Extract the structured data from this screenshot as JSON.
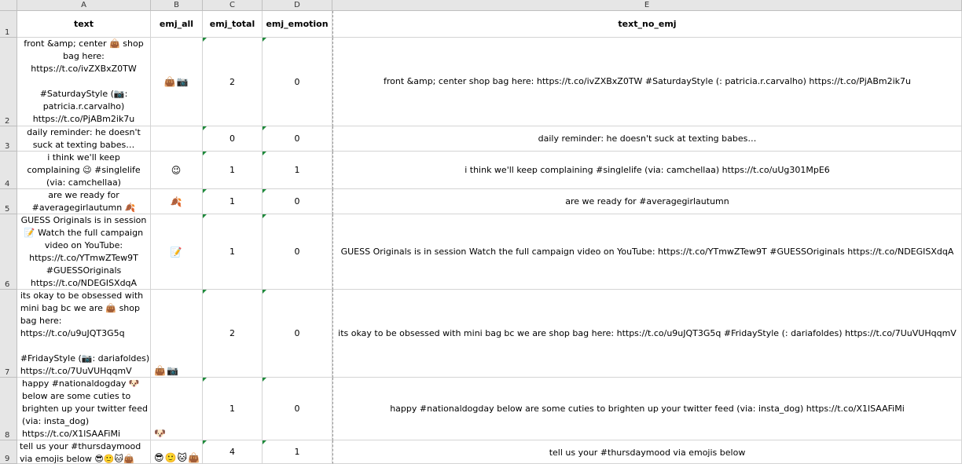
{
  "columns": [
    "A",
    "B",
    "C",
    "D",
    "E"
  ],
  "row_numbers": [
    "1",
    "2",
    "3",
    "4",
    "5",
    "6",
    "7",
    "8",
    "9"
  ],
  "headers": {
    "a": "text",
    "b": "emj_all",
    "c": "emj_total",
    "d": "emj_emotion",
    "e": "text_no_emj"
  },
  "rows": [
    {
      "a": "front &amp; center 👜 shop\nbag here:\nhttps://t.co/ivZXBxZ0TW\n\n#SaturdayStyle (📷:\npatricia.r.carvalho)\nhttps://t.co/PjABm2ik7u",
      "b": "👜📷",
      "c": "2",
      "d": "0",
      "e": "front &amp; center shop bag here: https://t.co/ivZXBxZ0TW #SaturdayStyle (: patricia.r.carvalho) https://t.co/PjABm2ik7u"
    },
    {
      "a": "daily reminder: he doesn't\nsuck at texting babes…",
      "b": "",
      "c": "0",
      "d": "0",
      "e": "daily reminder: he doesn't suck at texting babes…"
    },
    {
      "a": "i think we'll keep\ncomplaining 😉 #singlelife\n(via: camchellaa)",
      "b": "😉",
      "c": "1",
      "d": "1",
      "e": "i think we'll keep complaining #singlelife (via: camchellaa) https://t.co/uUg301MpE6"
    },
    {
      "a": "are we ready for\n#averagegirlautumn 🍂",
      "b": "🍂",
      "c": "1",
      "d": "0",
      "e": "are we ready for #averagegirlautumn"
    },
    {
      "a": "GUESS Originals is in session\n📝 Watch the full campaign\nvideo on YouTube:\nhttps://t.co/YTmwZTew9T\n#GUESSOriginals\nhttps://t.co/NDEGISXdqA",
      "b": "📝",
      "c": "1",
      "d": "0",
      "e": "GUESS Originals is in session Watch the full campaign video on YouTube: https://t.co/YTmwZTew9T #GUESSOriginals https://t.co/NDEGISXdqA"
    },
    {
      "a": "its okay to be obsessed with\nmini bag bc we are 👜 shop\nbag here:\nhttps://t.co/u9uJQT3G5q\n\n#FridayStyle (📷: dariafoldes)\nhttps://t.co/7UuVUHqqmV",
      "b": "👜📷",
      "c": "2",
      "d": "0",
      "e": "its okay to be obsessed with mini bag bc we are shop bag here: https://t.co/u9uJQT3G5q #FridayStyle (: dariafoldes) https://t.co/7UuVUHqqmV"
    },
    {
      "a": "happy #nationaldogday 🐶\nbelow are some cuties to\nbrighten up your twitter feed\n(via: insta_dog)\nhttps://t.co/X1lSAAFiMi",
      "b": "🐶",
      "c": "1",
      "d": "0",
      "e": "happy #nationaldogday below are some cuties to brighten up your twitter feed (via: insta_dog) https://t.co/X1lSAAFiMi"
    },
    {
      "a": "tell us your #thursdaymood\nvia emojis below 😎🙂🐱👜",
      "b": "😎🙂🐱👜",
      "c": "4",
      "d": "1",
      "e": "tell us your #thursdaymood via emojis below"
    }
  ]
}
